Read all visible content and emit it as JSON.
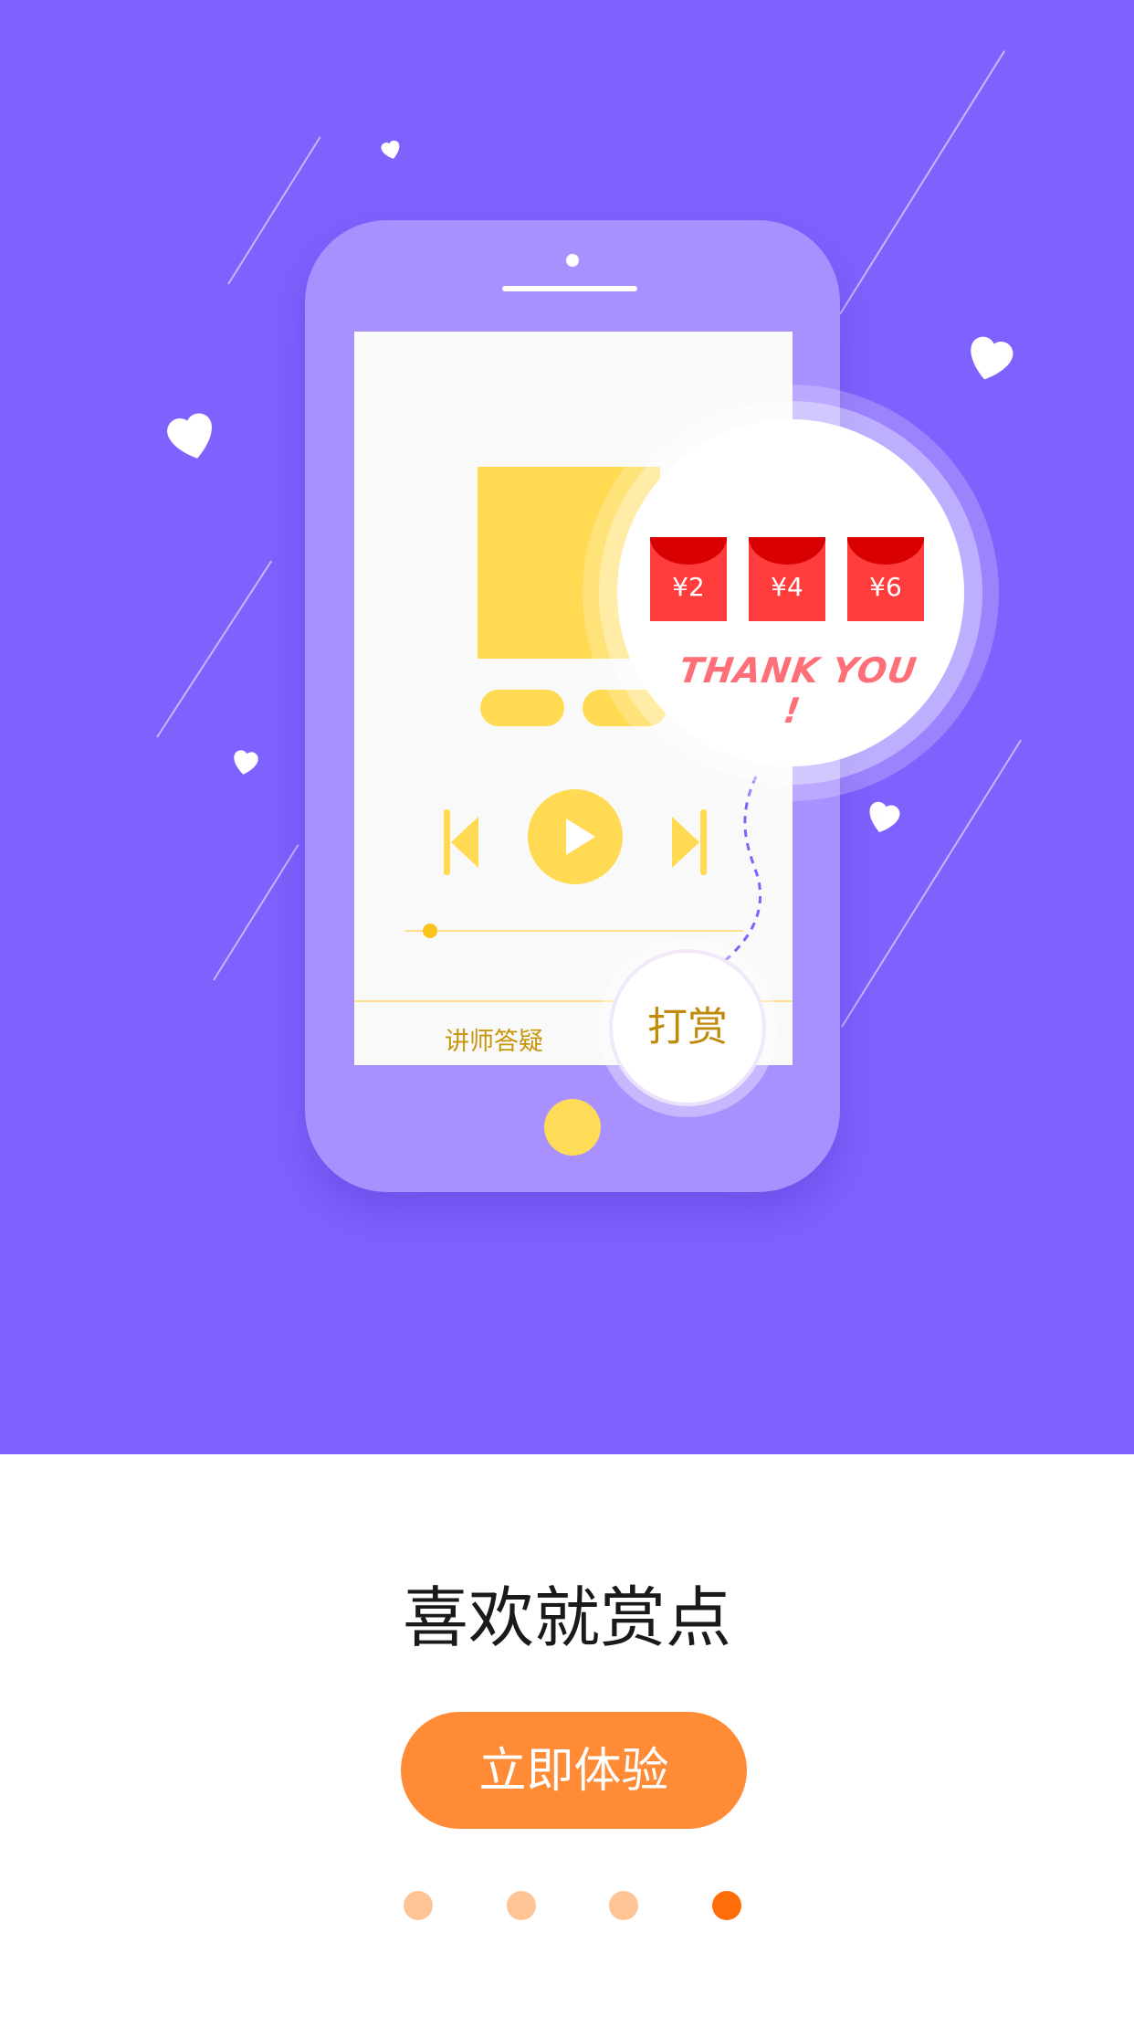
{
  "illustration": {
    "screen": {
      "tab_label": "讲师答疑",
      "progress": 0.06
    },
    "tip_button_label": "打赏",
    "reward_bubble": {
      "amounts": [
        "¥2",
        "¥4",
        "¥6"
      ],
      "message": "THANK YOU !"
    },
    "background_color": "#7f61fd"
  },
  "title": "喜欢就赏点",
  "cta_button_label": "立即体验",
  "pagination": {
    "total": 4,
    "active_index": 3
  },
  "colors": {
    "accent": "#ff8b36",
    "dot_active": "#ff6c0a",
    "dot_inactive": "#ffc495",
    "envelope": "#ff3d3d",
    "yellow": "#ffda52"
  }
}
